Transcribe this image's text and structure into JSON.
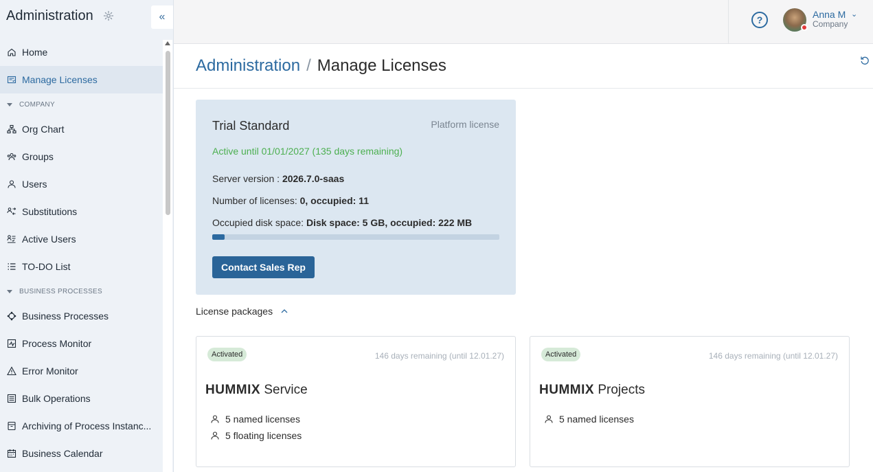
{
  "sidebar": {
    "title": "Administration",
    "collapse_glyph": "«",
    "items": [
      {
        "label": "Home",
        "icon": "home-icon"
      },
      {
        "label": "Manage Licenses",
        "icon": "license-icon",
        "active": true
      },
      {
        "section": "COMPANY"
      },
      {
        "label": "Org Chart",
        "icon": "org-chart-icon"
      },
      {
        "label": "Groups",
        "icon": "groups-icon"
      },
      {
        "label": "Users",
        "icon": "user-icon"
      },
      {
        "label": "Substitutions",
        "icon": "substitutions-icon"
      },
      {
        "label": "Active Users",
        "icon": "active-users-icon"
      },
      {
        "label": "TO-DO List",
        "icon": "list-icon"
      },
      {
        "section": "BUSINESS PROCESSES"
      },
      {
        "label": "Business Processes",
        "icon": "process-icon"
      },
      {
        "label": "Process Monitor",
        "icon": "monitor-icon"
      },
      {
        "label": "Error Monitor",
        "icon": "warning-icon"
      },
      {
        "label": "Bulk Operations",
        "icon": "bulk-icon"
      },
      {
        "label": "Archiving of Process Instanc...",
        "icon": "archive-icon"
      },
      {
        "label": "Business Calendar",
        "icon": "calendar-icon"
      }
    ]
  },
  "topbar": {
    "help_glyph": "?",
    "user": {
      "name": "Anna M",
      "company": "Company",
      "chevron": "⌄"
    }
  },
  "breadcrumb": {
    "parent": "Administration",
    "separator": "/",
    "current": "Manage Licenses"
  },
  "license": {
    "title": "Trial Standard",
    "type": "Platform license",
    "active": "Active until 01/01/2027 (135 days remaining)",
    "server_label": "Server version : ",
    "server_value": "2026.7.0-saas",
    "licenses_label": "Number of licenses: ",
    "licenses_value": "0, occupied: 11",
    "disk_label": "Occupied disk space: ",
    "disk_value": "Disk space: 5 GB, occupied: 222 MB",
    "disk_used_fraction": 0.043,
    "contact_button": "Contact Sales Rep"
  },
  "packages": {
    "heading": "License packages",
    "items": [
      {
        "badge": "Activated",
        "remaining": "146 days remaining (until 12.01.27)",
        "brand": "HUMMIX",
        "name": "Service",
        "licenses": [
          "5 named licenses",
          "5 floating licenses"
        ]
      },
      {
        "badge": "Activated",
        "remaining": "146 days remaining (until 12.01.27)",
        "brand": "HUMMIX",
        "name": "Projects",
        "licenses": [
          "5 named licenses"
        ]
      }
    ]
  },
  "colors": {
    "accent": "#2c6aa0",
    "active_text": "#4caf50",
    "card_bg": "#dce7f1",
    "badge_bg": "#d6ead8",
    "alert_dot": "#e23b3b"
  }
}
